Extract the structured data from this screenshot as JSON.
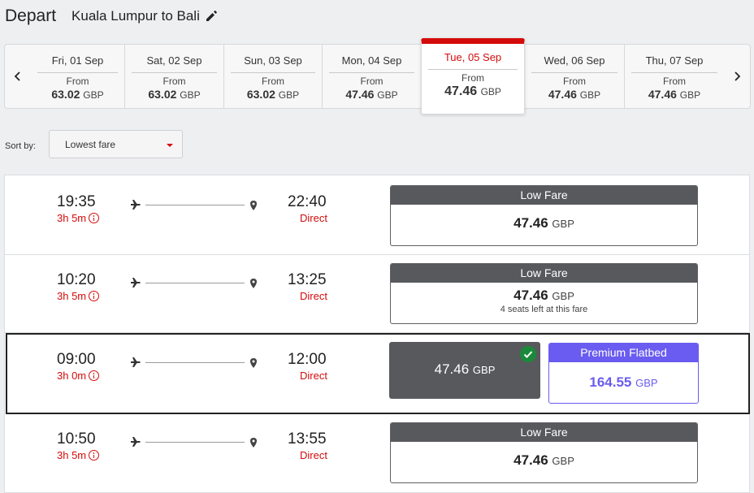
{
  "header": {
    "title": "Depart",
    "route": "Kuala Lumpur to Bali"
  },
  "datebar": {
    "dates": [
      {
        "label": "Fri, 01 Sep",
        "from": "From",
        "price": "63.02",
        "currency": "GBP"
      },
      {
        "label": "Sat, 02 Sep",
        "from": "From",
        "price": "63.02",
        "currency": "GBP"
      },
      {
        "label": "Sun, 03 Sep",
        "from": "From",
        "price": "63.02",
        "currency": "GBP"
      },
      {
        "label": "Mon, 04 Sep",
        "from": "From",
        "price": "47.46",
        "currency": "GBP"
      },
      {
        "label": "Tue, 05 Sep",
        "from": "From",
        "price": "47.46",
        "currency": "GBP"
      },
      {
        "label": "Wed, 06 Sep",
        "from": "From",
        "price": "47.46",
        "currency": "GBP"
      },
      {
        "label": "Thu, 07 Sep",
        "from": "From",
        "price": "47.46",
        "currency": "GBP"
      }
    ],
    "selected_date": "Tue, 05 Sep"
  },
  "sort": {
    "label": "Sort by:",
    "value": "Lowest fare"
  },
  "flights": [
    {
      "depart": "19:35",
      "duration": "3h 5m",
      "arrive": "22:40",
      "stops": "Direct",
      "fare": {
        "name": "Low Fare",
        "price": "47.46",
        "currency": "GBP",
        "note": ""
      }
    },
    {
      "depart": "10:20",
      "duration": "3h 5m",
      "arrive": "13:25",
      "stops": "Direct",
      "fare": {
        "name": "Low Fare",
        "price": "47.46",
        "currency": "GBP",
        "note": "4 seats left at this fare"
      }
    },
    {
      "depart": "09:00",
      "duration": "3h 0m",
      "arrive": "12:00",
      "stops": "Direct",
      "selected_fare": {
        "price": "47.46",
        "currency": "GBP"
      },
      "premium": {
        "name": "Premium Flatbed",
        "price": "164.55",
        "currency": "GBP"
      }
    },
    {
      "depart": "10:50",
      "duration": "3h 5m",
      "arrive": "13:55",
      "stops": "Direct",
      "fare": {
        "name": "Low Fare",
        "price": "47.46",
        "currency": "GBP",
        "note": ""
      }
    }
  ],
  "colors": {
    "accent": "#d40b0b",
    "premium": "#6a5cf0",
    "fare_header": "#58595d",
    "check": "#1a8a3a"
  }
}
